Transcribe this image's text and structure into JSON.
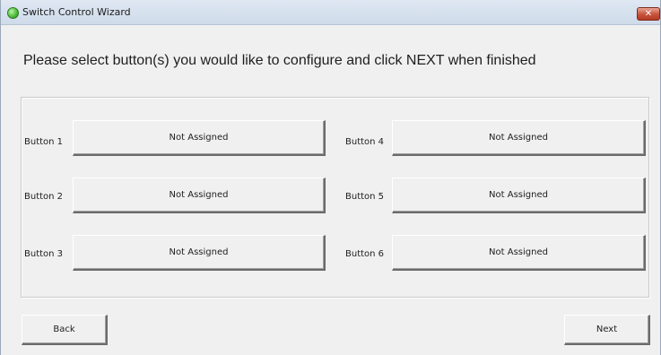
{
  "window": {
    "title": "Switch Control Wizard",
    "close_glyph": "✕",
    "icon": "green-orb-icon"
  },
  "instruction": "Please select button(s) you would like to configure and click NEXT when finished",
  "buttons": [
    {
      "label": "Button 1",
      "value": "Not Assigned"
    },
    {
      "label": "Button 2",
      "value": "Not Assigned"
    },
    {
      "label": "Button 3",
      "value": "Not Assigned"
    },
    {
      "label": "Button 4",
      "value": "Not Assigned"
    },
    {
      "label": "Button 5",
      "value": "Not Assigned"
    },
    {
      "label": "Button 6",
      "value": "Not Assigned"
    }
  ],
  "nav": {
    "back_label": "Back",
    "next_label": "Next"
  },
  "colors": {
    "window_bg": "#f0f0f0",
    "titlebar": "#dfe8f3",
    "close_button": "#c8523b"
  }
}
